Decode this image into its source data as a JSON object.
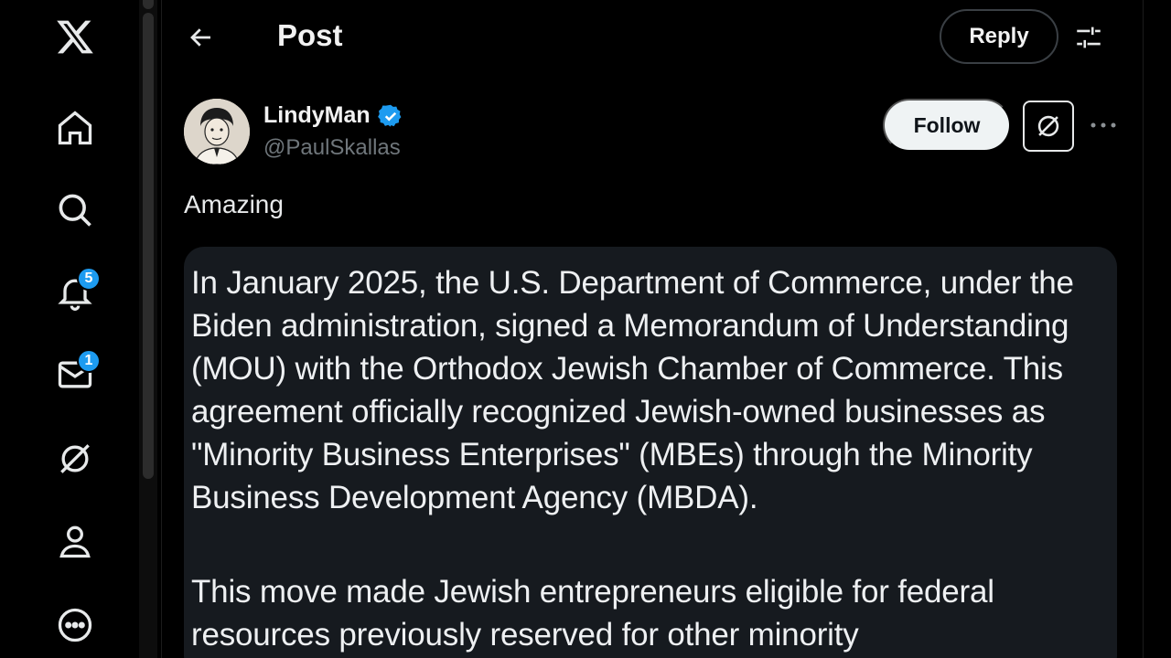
{
  "nav": {
    "items": [
      {
        "name": "x-logo",
        "label": "X"
      },
      {
        "name": "home",
        "label": "Home"
      },
      {
        "name": "explore",
        "label": "Explore"
      },
      {
        "name": "notifications",
        "label": "Notifications",
        "badge": "5"
      },
      {
        "name": "messages",
        "label": "Messages",
        "badge": "1"
      },
      {
        "name": "grok",
        "label": "Grok"
      },
      {
        "name": "profile",
        "label": "Profile"
      },
      {
        "name": "more",
        "label": "More"
      }
    ]
  },
  "header": {
    "title": "Post",
    "reply_label": "Reply"
  },
  "post": {
    "display_name": "LindyMan",
    "handle": "@PaulSkallas",
    "follow_label": "Follow",
    "text": "Amazing",
    "media_text": {
      "para1": "In January 2025, the U.S. Department of Commerce, under the Biden administration, signed a Memorandum of Understanding (MOU) with the Orthodox Jewish Chamber of Commerce. This agreement officially recognized Jewish-owned businesses as \"Minority Business Enterprises\" (MBEs) through the Minority Business Development Agency (MBDA).",
      "para2": "This move made Jewish entrepreneurs eligible for federal resources previously reserved for other minority"
    }
  },
  "colors": {
    "accent": "#1d9bf0",
    "background": "#000000",
    "card": "#161a1f"
  }
}
